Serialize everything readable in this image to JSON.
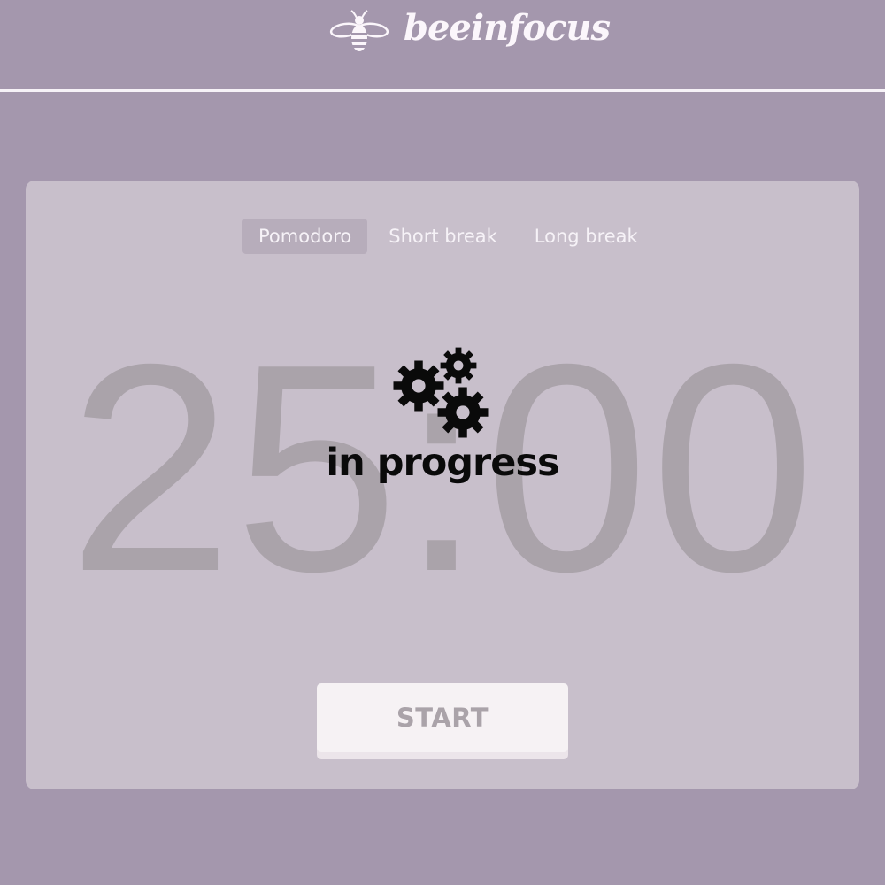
{
  "header": {
    "brand": "beeinfocus",
    "logo_icon": "bee-icon"
  },
  "tabs": [
    {
      "label": "Pomodoro",
      "active": true
    },
    {
      "label": "Short break",
      "active": false
    },
    {
      "label": "Long break",
      "active": false
    }
  ],
  "timer": {
    "display": "25:00"
  },
  "overlay": {
    "icon": "gears-icon",
    "status": "in progress"
  },
  "controls": {
    "start_label": "START"
  },
  "colors": {
    "background": "#a497ad",
    "card": "#c8bfcb",
    "active_tab": "#b7adbb",
    "timer_text": "#aaa3aa",
    "button": "#f6f2f4"
  }
}
